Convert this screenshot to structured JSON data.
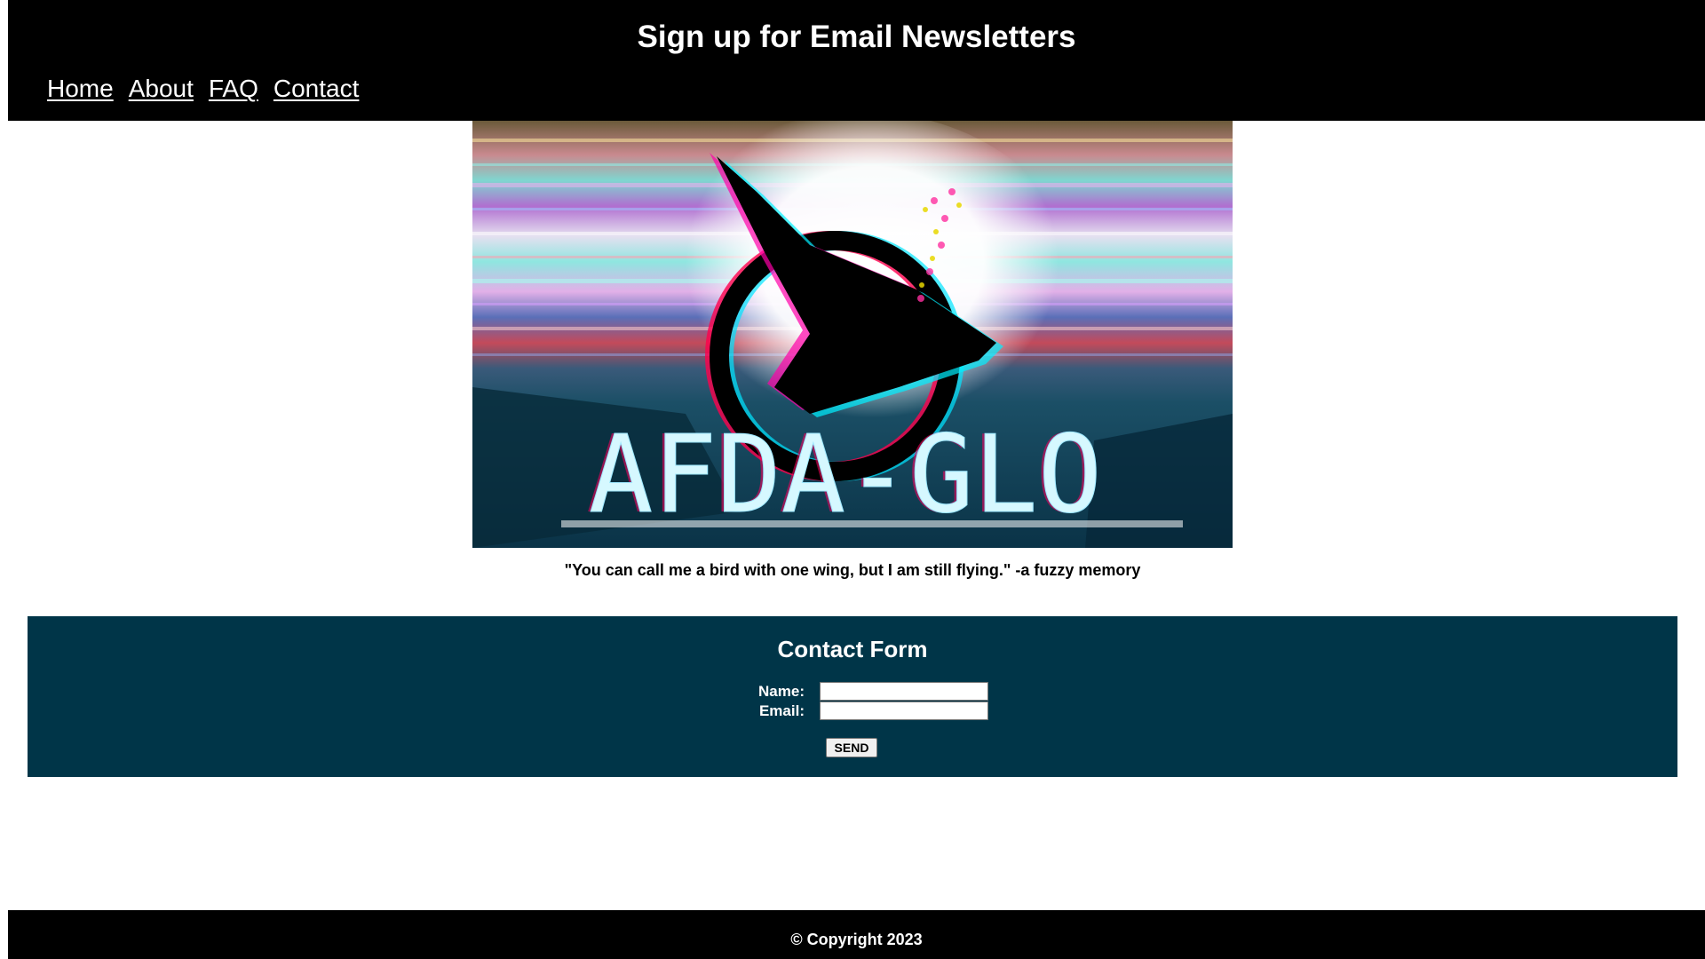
{
  "header": {
    "title": "Sign up for Email Newsletters",
    "nav": [
      "Home",
      "About",
      "FAQ",
      "Contact"
    ]
  },
  "hero": {
    "logo_text": "AFDA-GLO",
    "quote": "\"You can call me a bird with one wing, but I am still flying.\" -a fuzzy memory"
  },
  "contact_form": {
    "title": "Contact Form",
    "name_label": "Name:",
    "email_label": "Email:",
    "name_value": "",
    "email_value": "",
    "send_label": "SEND"
  },
  "footer": {
    "copyright": "© Copyright 2023"
  },
  "colors": {
    "header_bg": "#000000",
    "contact_bg": "#003548",
    "footer_bg": "#000000",
    "logo_teal": "#0c3b4f"
  }
}
